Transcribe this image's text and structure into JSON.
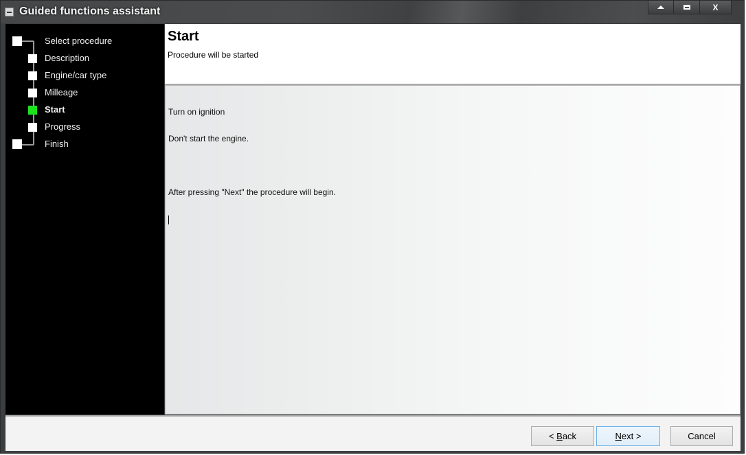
{
  "window": {
    "title": "Guided functions assistant",
    "controls": [
      "minimize",
      "maximize",
      "close"
    ],
    "close_label": "X"
  },
  "steps": [
    {
      "label": "Select procedure",
      "state": "done",
      "level": 0
    },
    {
      "label": "Description",
      "state": "done",
      "level": 1
    },
    {
      "label": "Engine/car type",
      "state": "done",
      "level": 1
    },
    {
      "label": "Milleage",
      "state": "done",
      "level": 1
    },
    {
      "label": "Start",
      "state": "active",
      "level": 1
    },
    {
      "label": "Progress",
      "state": "pending",
      "level": 1
    },
    {
      "label": "Finish",
      "state": "pending",
      "level": 0
    }
  ],
  "header": {
    "title": "Start",
    "subtitle": "Procedure will be started"
  },
  "content": {
    "lines": [
      "Turn on ignition",
      "Don't start the engine.",
      "",
      "After pressing \"Next\" the procedure will begin."
    ]
  },
  "footer": {
    "back": {
      "prefix": "< ",
      "mnemonic": "B",
      "rest": "ack"
    },
    "next": {
      "prefix": "",
      "mnemonic": "N",
      "rest": "ext >"
    },
    "cancel": "Cancel"
  },
  "colors": {
    "active_step": "#1ee11e",
    "sidebar_bg": "#000000",
    "default_button_border": "#6fb1e4"
  }
}
